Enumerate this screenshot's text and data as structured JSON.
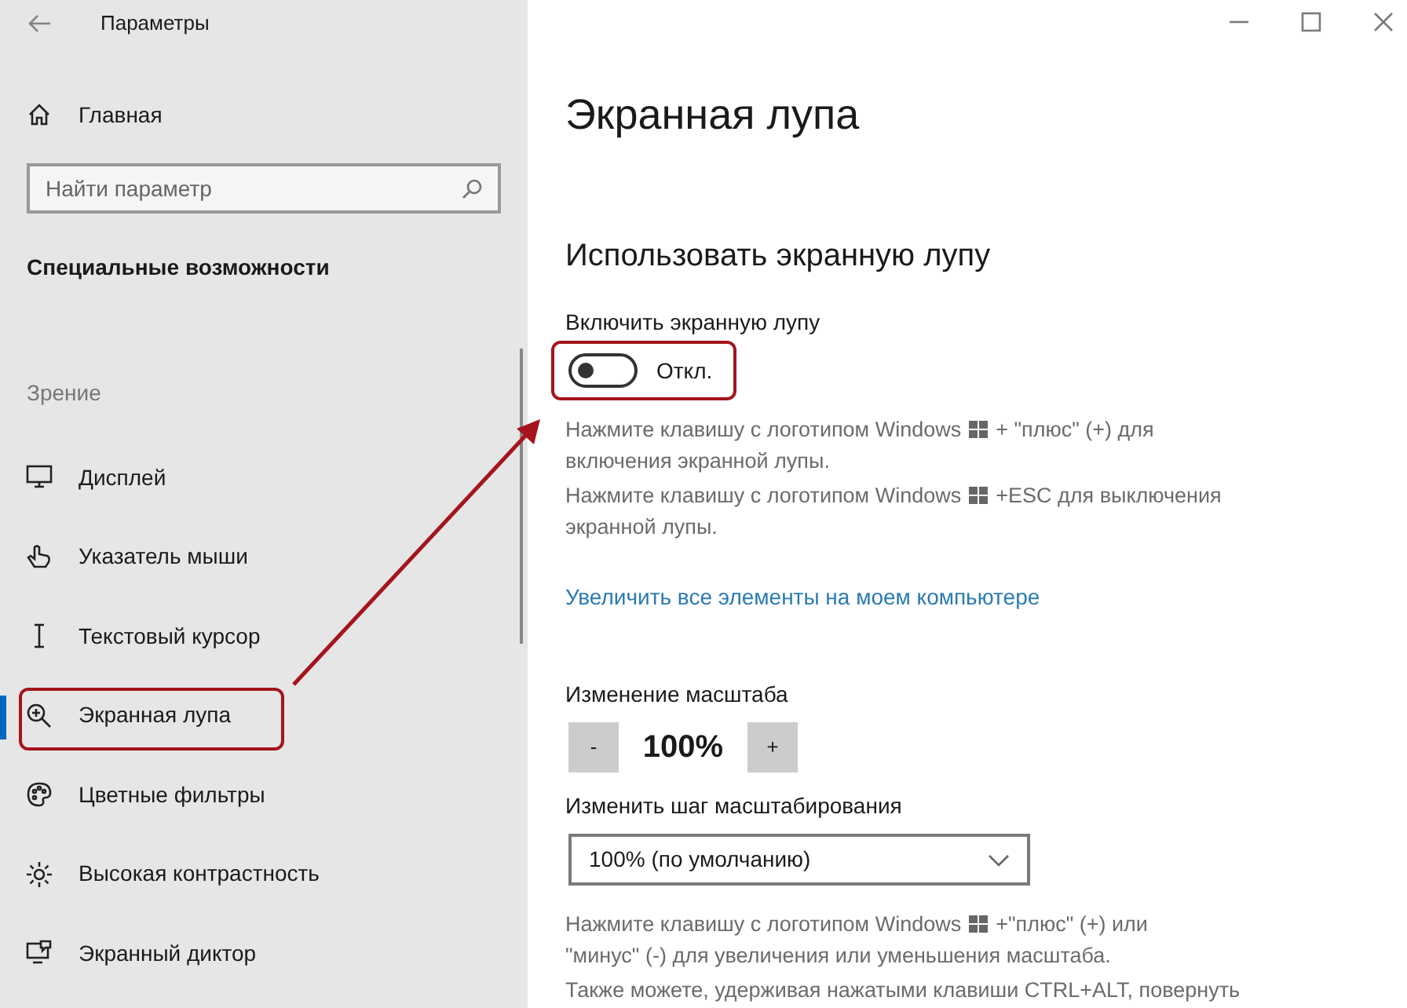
{
  "window": {
    "title": "Параметры"
  },
  "sidebar": {
    "home": "Главная",
    "search": {
      "placeholder": "Найти параметр"
    },
    "section": "Специальные возможности",
    "group": "Зрение",
    "items": [
      {
        "label": "Дисплей",
        "kind": "display",
        "selected": false,
        "annotated": false
      },
      {
        "label": "Указатель мыши",
        "kind": "pointer",
        "selected": false,
        "annotated": false
      },
      {
        "label": "Текстовый курсор",
        "kind": "cursor",
        "selected": false,
        "annotated": false
      },
      {
        "label": "Экранная лупа",
        "kind": "magnifier",
        "selected": true,
        "annotated": true
      },
      {
        "label": "Цветные фильтры",
        "kind": "palette",
        "selected": false,
        "annotated": false
      },
      {
        "label": "Высокая контрастность",
        "kind": "sun",
        "selected": false,
        "annotated": false
      },
      {
        "label": "Экранный диктор",
        "kind": "narrator",
        "selected": false,
        "annotated": false
      }
    ]
  },
  "main": {
    "title": "Экранная лупа",
    "section": "Использовать экранную лупу",
    "toggle": {
      "label": "Включить экранную лупу",
      "on": false,
      "state_text": "Откл.",
      "annotated": true
    },
    "hints": [
      {
        "before": "Нажмите клавишу с логотипом Windows",
        "after": "+ \"плюс\" (+) для",
        "line2": "включения экранной лупы."
      },
      {
        "before": "Нажмите клавишу с логотипом Windows",
        "after": "+ESC для выключения",
        "line2": "экранной лупы."
      }
    ],
    "link": "Увеличить все элементы на моем компьютере",
    "zoom": {
      "label": "Изменение масштаба",
      "minus": "-",
      "value": "100%",
      "plus": "+"
    },
    "step": {
      "label": "Изменить шаг масштабирования",
      "value": "100% (по умолчанию)"
    },
    "hints2": [
      {
        "before": "Нажмите клавишу с логотипом Windows",
        "after": "+\"плюс\" (+) или",
        "line2": "\"минус\" (-) для увеличения или уменьшения масштаба."
      },
      {
        "text": "Также можете, удерживая нажатыми клавиши CTRL+ALT, повернуть"
      }
    ]
  }
}
